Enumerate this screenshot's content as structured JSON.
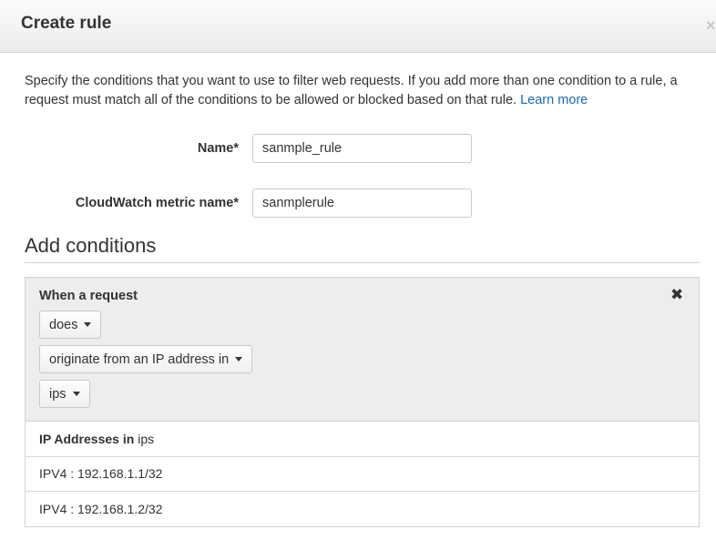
{
  "dialog": {
    "title": "Create rule",
    "close_label": "×"
  },
  "intro": {
    "text": "Specify the conditions that you want to use to filter web requests. If you add more than one condition to a rule, a request must match all of the conditions to be allowed or blocked based on that rule.",
    "link": "Learn more"
  },
  "form": {
    "name_label": "Name*",
    "name_value": "sanmple_rule",
    "metric_label": "CloudWatch metric name*",
    "metric_value": "sanmplerule"
  },
  "conditions": {
    "section_title": "Add conditions",
    "heading": "When a request",
    "remove_label": "✖",
    "match_type": "does",
    "condition_type": "originate from an IP address in",
    "ip_set": "ips"
  },
  "ip_addresses": {
    "header_bold": "IP Addresses in",
    "header_set": "ips",
    "rows": [
      "IPV4 : 192.168.1.1/32",
      "IPV4 : 192.168.1.2/32"
    ]
  }
}
